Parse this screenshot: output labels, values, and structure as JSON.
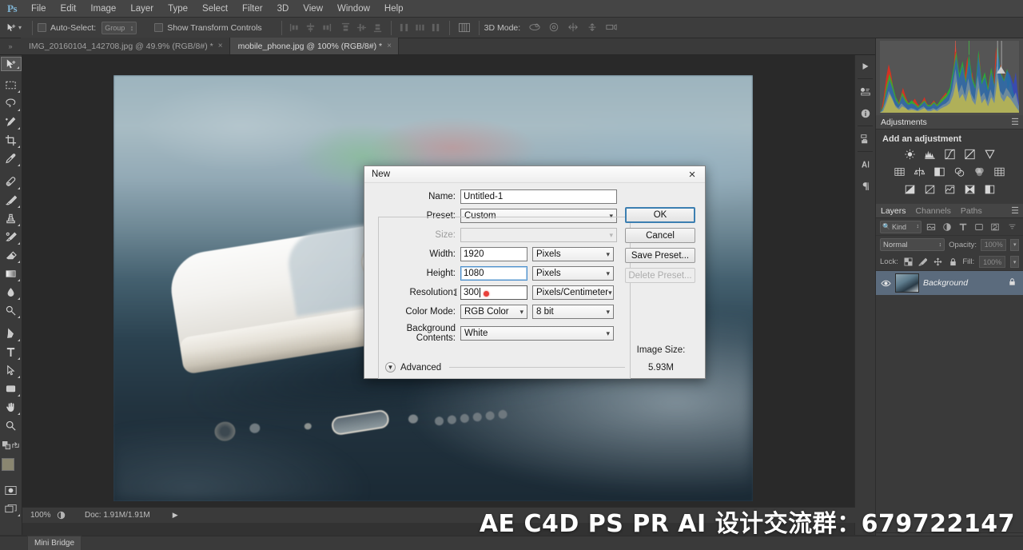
{
  "app": {
    "logo": "Ps",
    "menu": [
      "File",
      "Edit",
      "Image",
      "Layer",
      "Type",
      "Select",
      "Filter",
      "3D",
      "View",
      "Window",
      "Help"
    ]
  },
  "options_bar": {
    "auto_select_label": "Auto-Select:",
    "auto_select_value": "Group",
    "show_transform_label": "Show Transform Controls",
    "mode_3d_label": "3D Mode:"
  },
  "tabs": [
    {
      "title": "IMG_20160104_142708.jpg @ 49.9% (RGB/8#) *",
      "close": "×",
      "active": false
    },
    {
      "title": "mobile_phone.jpg @ 100% (RGB/8#) *",
      "close": "×",
      "active": true
    }
  ],
  "tools": [
    {
      "name": "move-tool",
      "selected": true
    },
    {
      "name": "marquee-tool",
      "selected": false
    },
    {
      "name": "lasso-tool",
      "selected": false
    },
    {
      "name": "quick-select-tool",
      "selected": false
    },
    {
      "name": "crop-tool",
      "selected": false
    },
    {
      "name": "eyedropper-tool",
      "selected": false
    },
    {
      "name": "healing-brush-tool",
      "selected": false
    },
    {
      "name": "brush-tool",
      "selected": false
    },
    {
      "name": "clone-stamp-tool",
      "selected": false
    },
    {
      "name": "history-brush-tool",
      "selected": false
    },
    {
      "name": "eraser-tool",
      "selected": false
    },
    {
      "name": "gradient-tool",
      "selected": false
    },
    {
      "name": "blur-tool",
      "selected": false
    },
    {
      "name": "dodge-tool",
      "selected": false
    },
    {
      "name": "pen-tool",
      "selected": false
    },
    {
      "name": "type-tool",
      "selected": false
    },
    {
      "name": "path-selection-tool",
      "selected": false
    },
    {
      "name": "rectangle-tool",
      "selected": false
    },
    {
      "name": "hand-tool",
      "selected": false
    },
    {
      "name": "zoom-tool",
      "selected": false
    }
  ],
  "dialog": {
    "title": "New",
    "close": "×",
    "fields": {
      "name_label": "Name:",
      "name_value": "Untitled-1",
      "preset_label": "Preset:",
      "preset_value": "Custom",
      "size_label": "Size:",
      "size_value": "",
      "width_label": "Width:",
      "width_value": "1920",
      "width_unit": "Pixels",
      "height_label": "Height:",
      "height_value": "1080",
      "height_unit": "Pixels",
      "resolution_label": "Resolution:",
      "resolution_value": "300",
      "resolution_unit": "Pixels/Centimeter",
      "color_mode_label": "Color Mode:",
      "color_mode_value": "RGB Color",
      "bit_depth_value": "8 bit",
      "background_label": "Background Contents:",
      "background_value": "White",
      "advanced_label": "Advanced"
    },
    "buttons": {
      "ok": "OK",
      "cancel": "Cancel",
      "save_preset": "Save Preset...",
      "delete_preset": "Delete Preset..."
    },
    "image_size": {
      "label": "Image Size:",
      "value": "5.93M"
    }
  },
  "panels": {
    "histogram": {
      "name": "Histogram"
    },
    "adjustments": {
      "tab": "Adjustments",
      "subtitle": "Add an adjustment",
      "icons": [
        [
          "brightness-contrast-icon",
          "levels-icon",
          "curves-icon",
          "exposure-icon",
          "vibrance-icon"
        ],
        [
          "hue-saturation-icon",
          "color-balance-icon",
          "black-white-icon",
          "photo-filter-icon",
          "channel-mixer-icon",
          "color-lookup-icon"
        ],
        [
          "invert-icon",
          "posterize-icon",
          "threshold-icon",
          "selective-color-icon",
          "gradient-map-icon"
        ]
      ]
    },
    "layers": {
      "tabs": [
        "Layers",
        "Channels",
        "Paths"
      ],
      "active_tab": "Layers",
      "kind_filter": "Kind",
      "blend_mode": "Normal",
      "opacity_label": "Opacity:",
      "opacity_value": "100%",
      "lock_label": "Lock:",
      "fill_label": "Fill:",
      "fill_value": "100%",
      "rows": [
        {
          "name": "Background",
          "locked": true,
          "visible": true
        }
      ]
    }
  },
  "statusbar": {
    "zoom": "100%",
    "doc_info": "Doc: 1.91M/1.91M",
    "mini_bridge": "Mini Bridge"
  },
  "watermark": {
    "text": "AE C4D PS PR AI 设计交流群：679722147"
  },
  "colors": {
    "accent_blue": "#3c7fb1",
    "chrome_dark": "#3a3a3a",
    "chrome_mid": "#454545",
    "canvas_bg": "#292929",
    "layer_selected": "#5b6b7d",
    "foreground_swatch": "#8a8670",
    "background_swatch": "#6fa8dc",
    "cursor_red": "#e8403a"
  }
}
